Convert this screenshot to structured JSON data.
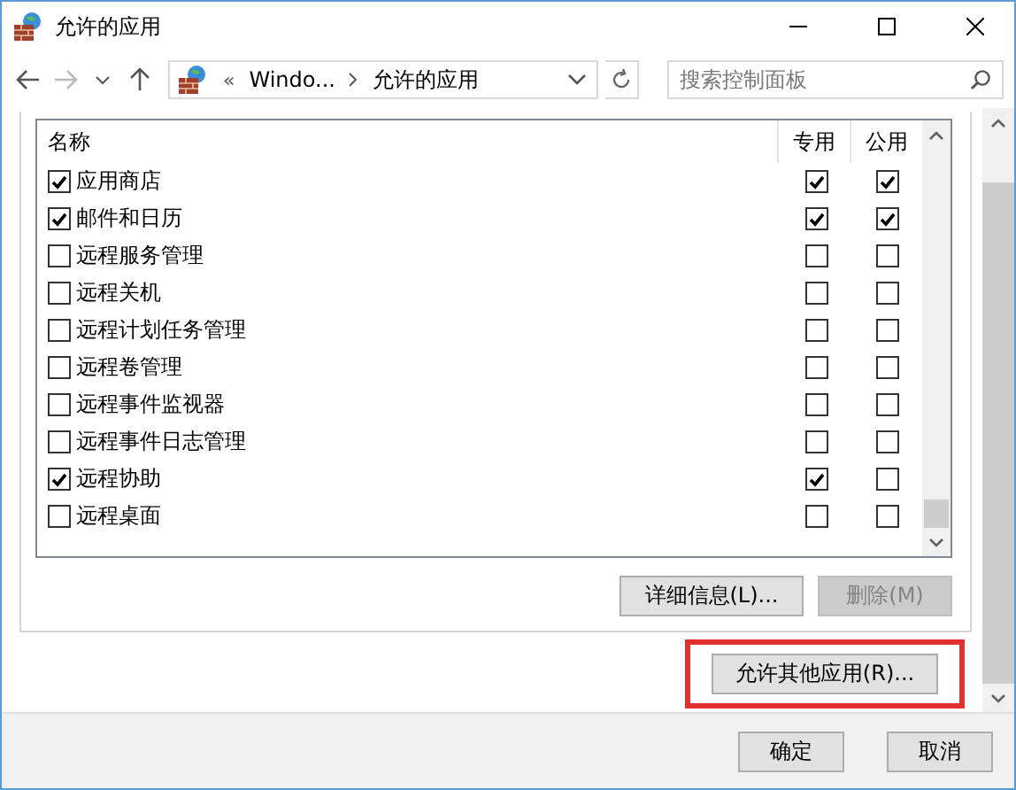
{
  "window": {
    "title": "允许的应用"
  },
  "address": {
    "overflow": "«",
    "crumbs": [
      "Windo...",
      "允许的应用"
    ]
  },
  "search": {
    "placeholder": "搜索控制面板"
  },
  "table": {
    "columns": [
      "名称",
      "专用",
      "公用"
    ],
    "rows": [
      {
        "name": "应用商店",
        "checked": true,
        "private": true,
        "public": true
      },
      {
        "name": "邮件和日历",
        "checked": true,
        "private": true,
        "public": true
      },
      {
        "name": "远程服务管理",
        "checked": false,
        "private": false,
        "public": false
      },
      {
        "name": "远程关机",
        "checked": false,
        "private": false,
        "public": false
      },
      {
        "name": "远程计划任务管理",
        "checked": false,
        "private": false,
        "public": false
      },
      {
        "name": "远程卷管理",
        "checked": false,
        "private": false,
        "public": false
      },
      {
        "name": "远程事件监视器",
        "checked": false,
        "private": false,
        "public": false
      },
      {
        "name": "远程事件日志管理",
        "checked": false,
        "private": false,
        "public": false
      },
      {
        "name": "远程协助",
        "checked": true,
        "private": true,
        "public": false
      },
      {
        "name": "远程桌面",
        "checked": false,
        "private": false,
        "public": false
      }
    ]
  },
  "list_buttons": [
    {
      "label": "详细信息(L)...",
      "disabled": false
    },
    {
      "label": "删除(M)",
      "disabled": true
    }
  ],
  "allow_button": {
    "label": "允许其他应用(R)..."
  },
  "footer_buttons": [
    "确定",
    "取消"
  ]
}
